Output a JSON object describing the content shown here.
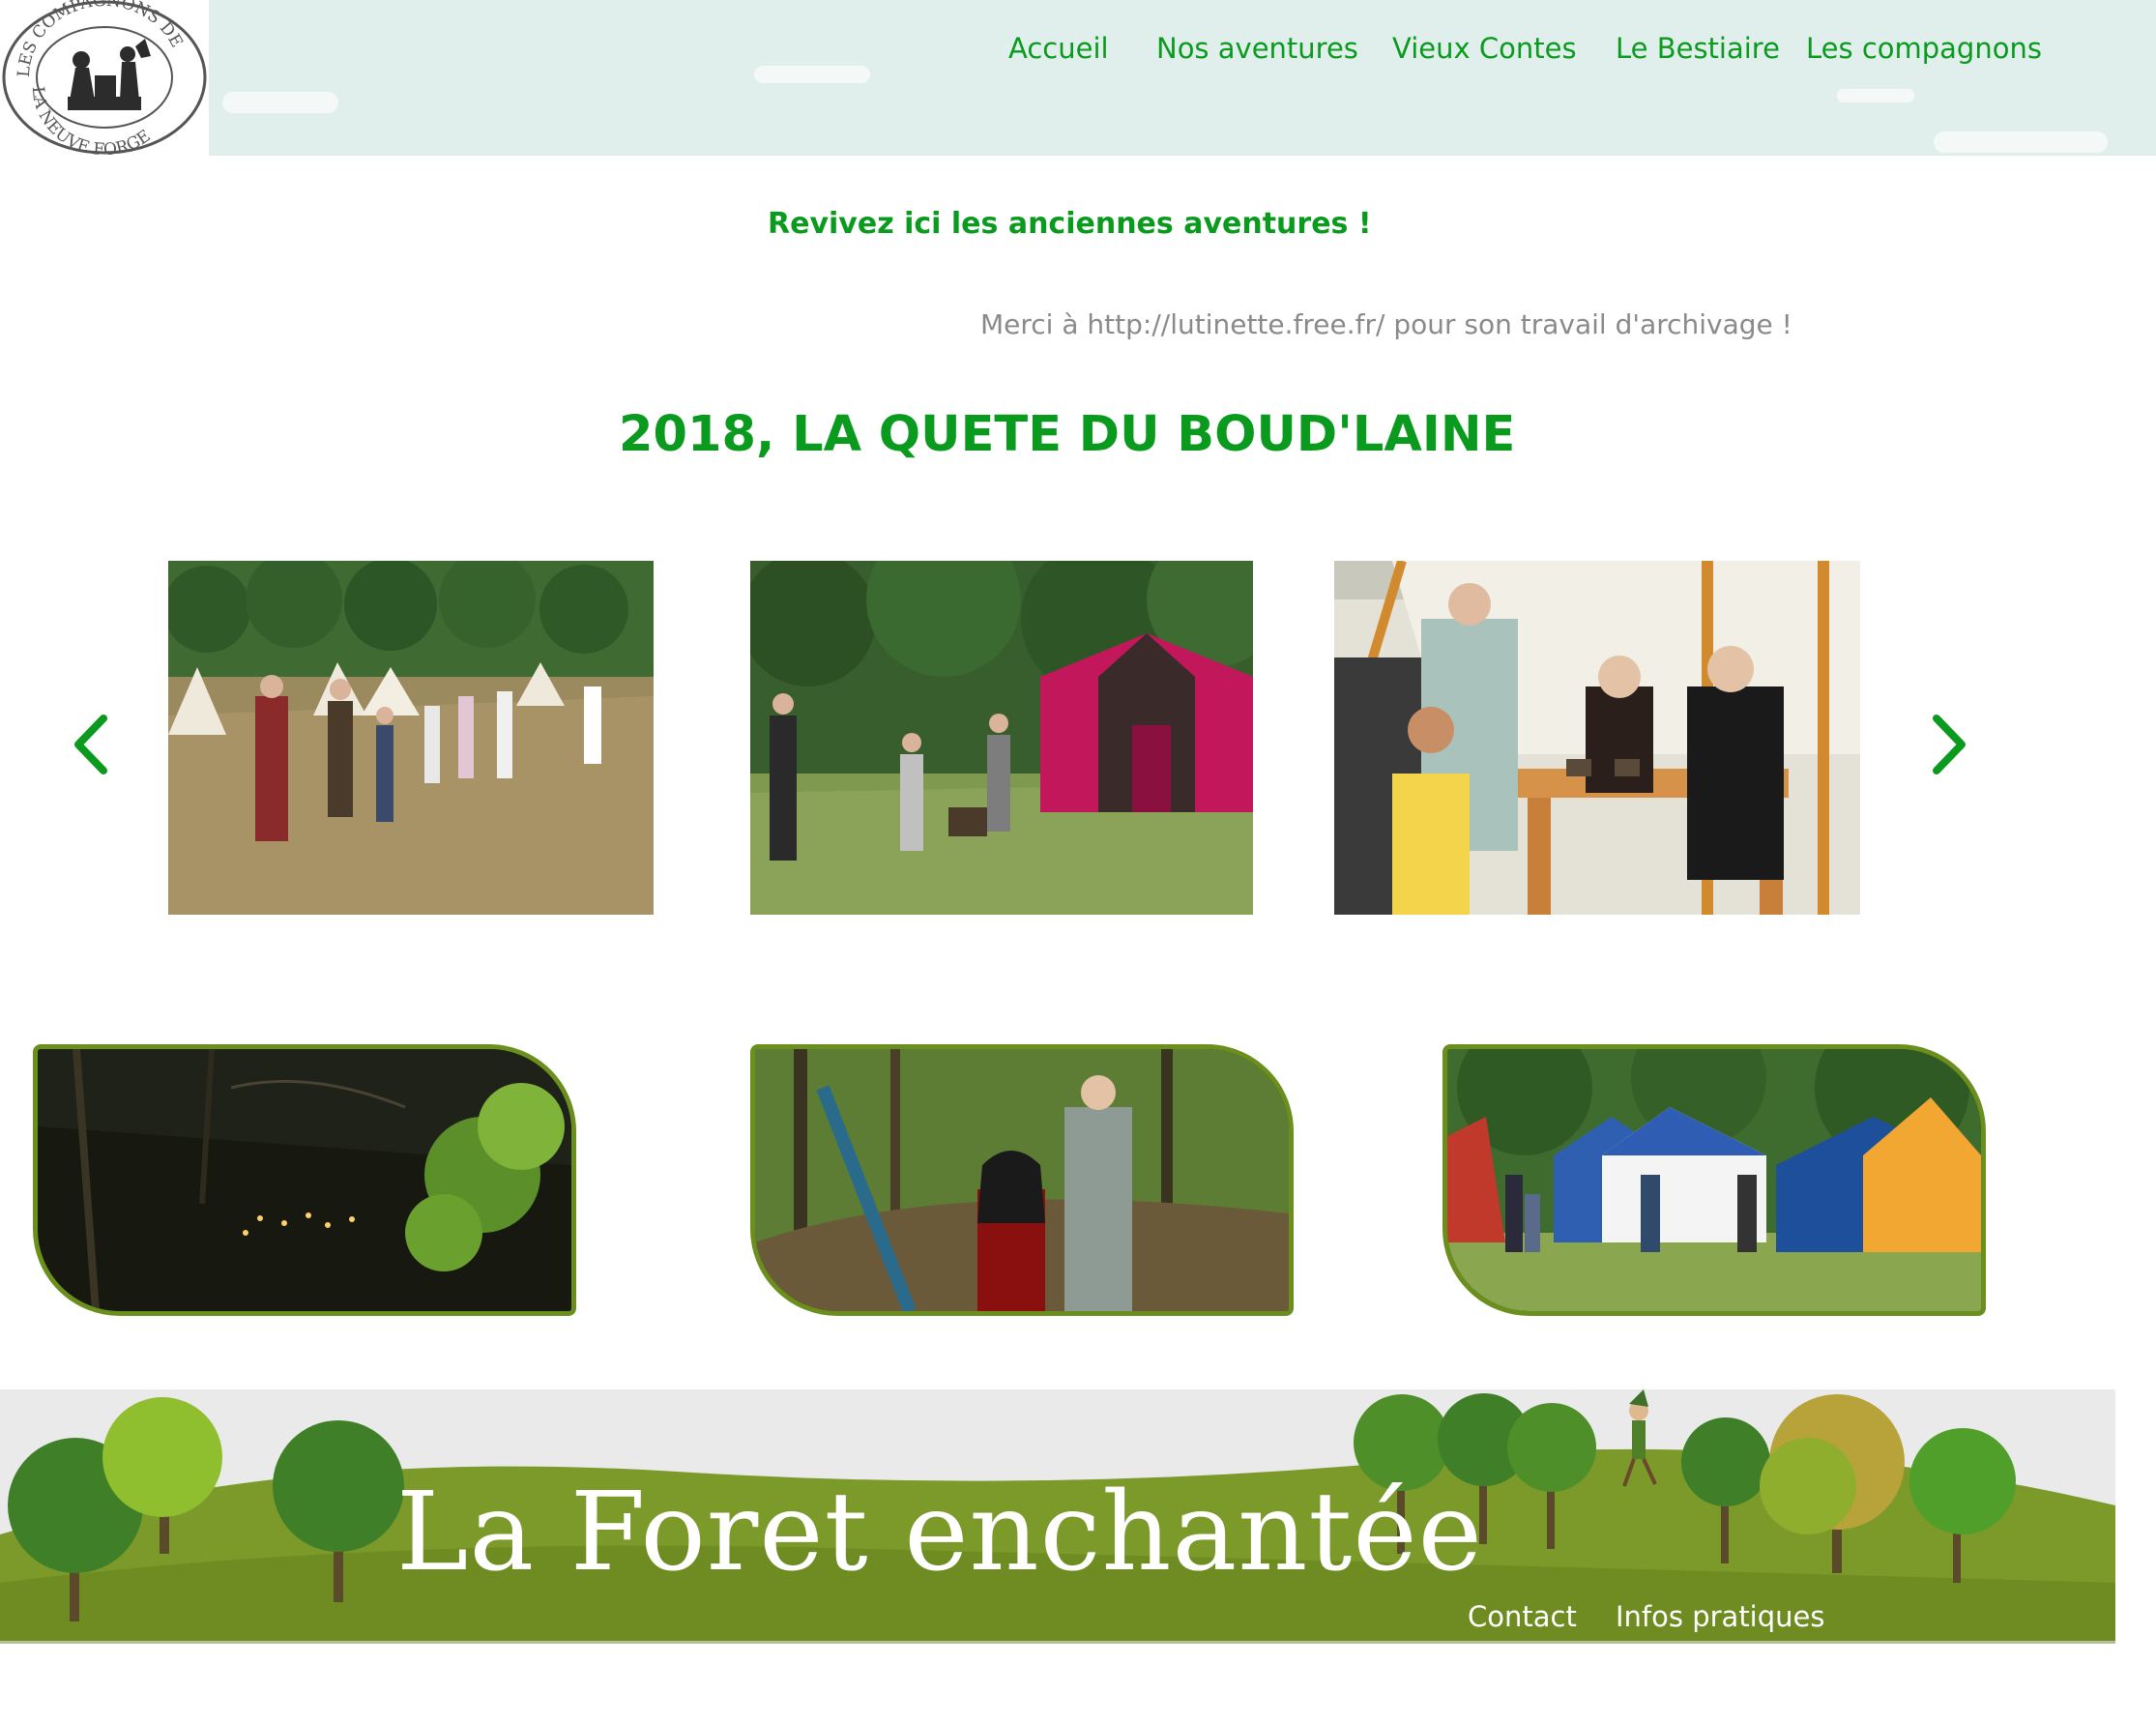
{
  "logo": {
    "text_top": "LES COMPAGNONS DE",
    "text_bottom": "LA NEUVE FORGE"
  },
  "nav": [
    {
      "label": "Accueil"
    },
    {
      "label": "Nos aventures"
    },
    {
      "label": "Vieux Contes"
    },
    {
      "label": "Le Bestiaire"
    },
    {
      "label": "Les compagnons"
    }
  ],
  "main": {
    "intro": "Revivez ici les anciennes aventures !",
    "credit": "Merci à http://lutinette.free.fr/ pour son travail d'archivage !",
    "title": "2018, LA QUETE DU BOUD'LAINE"
  },
  "carousel": {
    "slides": [
      {
        "subject": "camp-children-photo"
      },
      {
        "subject": "pink-tent-photo"
      },
      {
        "subject": "registration-table-photo"
      }
    ],
    "prev_icon": "chevron-left-icon",
    "next_icon": "chevron-right-icon"
  },
  "cards": [
    {
      "subject": "night-forest-photo"
    },
    {
      "subject": "forest-couple-photo"
    },
    {
      "subject": "colorful-tents-photo"
    }
  ],
  "footer": {
    "title": "La Foret enchantée",
    "links": [
      {
        "label": "Contact"
      },
      {
        "label": "Infos pratiques"
      }
    ]
  },
  "colors": {
    "accent_green": "#0a9a1e",
    "credit_gray": "#8a8a8a",
    "header_bg": "#e1efec",
    "card_border": "#6b8f1c",
    "footer_grass": "#7b9a2a"
  }
}
